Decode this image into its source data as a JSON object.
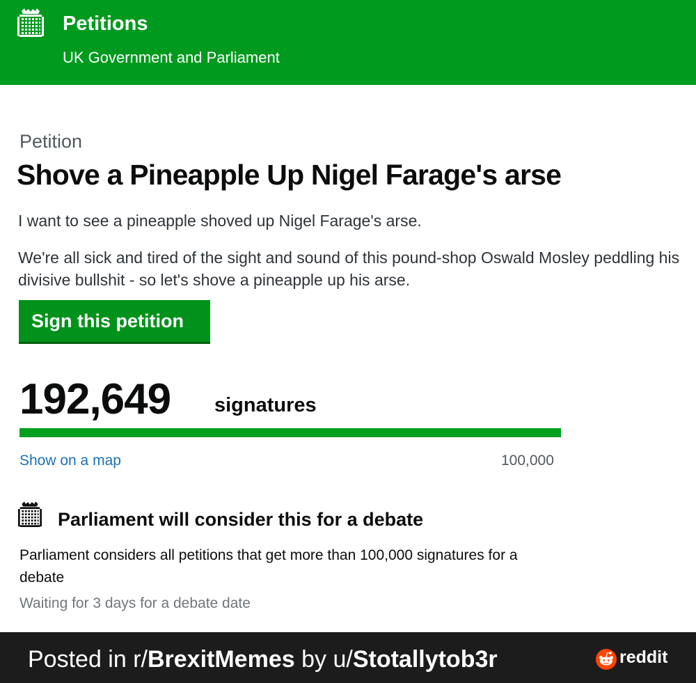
{
  "header": {
    "title": "Petitions",
    "subtitle": "UK Government and Parliament",
    "logo_icon": "portcullis-icon",
    "background": "#009a1e"
  },
  "petition": {
    "kicker": "Petition",
    "title": "Shove a Pineapple Up Nigel Farage's arse",
    "action": "I want to see a pineapple shoved up Nigel Farage's arse.",
    "details": "We're all sick and tired of the sight and sound of this pound-shop Oswald Mosley peddling his divisive bullshit - so let's shove a pineapple up his arse.",
    "sign_button_label": "Sign this petition"
  },
  "signatures": {
    "count": "192,649",
    "label": "signatures",
    "progress_fraction": 1.0,
    "threshold": "100,000",
    "map_link": "Show on a map"
  },
  "debate": {
    "icon": "portcullis-icon",
    "heading": "Parliament will consider this for a debate",
    "text": "Parliament considers all petitions that get more than 100,000 signatures for a debate",
    "waiting": "Waiting for 3 days for a debate date"
  },
  "footer": {
    "posted_prefix": "Posted in r/",
    "subreddit": "BrexitMemes",
    "by_prefix": " by u/",
    "username": "Stotallytob3r",
    "brand": "reddit",
    "brand_icon": "reddit-snoo-icon",
    "brand_color": "#ff4500"
  }
}
